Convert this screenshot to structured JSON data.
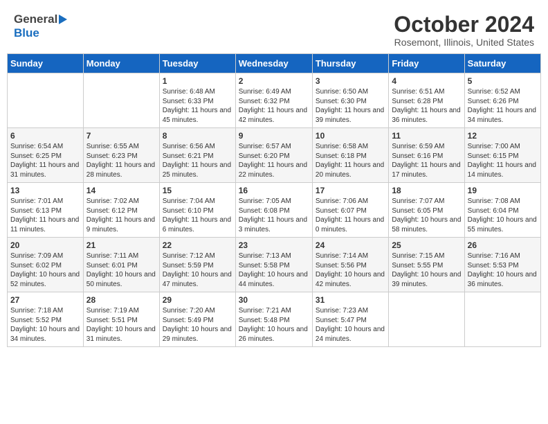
{
  "header": {
    "logo_general": "General",
    "logo_blue": "Blue",
    "month": "October 2024",
    "location": "Rosemont, Illinois, United States"
  },
  "days_of_week": [
    "Sunday",
    "Monday",
    "Tuesday",
    "Wednesday",
    "Thursday",
    "Friday",
    "Saturday"
  ],
  "weeks": [
    [
      {
        "day": "",
        "sunrise": "",
        "sunset": "",
        "daylight": ""
      },
      {
        "day": "",
        "sunrise": "",
        "sunset": "",
        "daylight": ""
      },
      {
        "day": "1",
        "sunrise": "Sunrise: 6:48 AM",
        "sunset": "Sunset: 6:33 PM",
        "daylight": "Daylight: 11 hours and 45 minutes."
      },
      {
        "day": "2",
        "sunrise": "Sunrise: 6:49 AM",
        "sunset": "Sunset: 6:32 PM",
        "daylight": "Daylight: 11 hours and 42 minutes."
      },
      {
        "day": "3",
        "sunrise": "Sunrise: 6:50 AM",
        "sunset": "Sunset: 6:30 PM",
        "daylight": "Daylight: 11 hours and 39 minutes."
      },
      {
        "day": "4",
        "sunrise": "Sunrise: 6:51 AM",
        "sunset": "Sunset: 6:28 PM",
        "daylight": "Daylight: 11 hours and 36 minutes."
      },
      {
        "day": "5",
        "sunrise": "Sunrise: 6:52 AM",
        "sunset": "Sunset: 6:26 PM",
        "daylight": "Daylight: 11 hours and 34 minutes."
      }
    ],
    [
      {
        "day": "6",
        "sunrise": "Sunrise: 6:54 AM",
        "sunset": "Sunset: 6:25 PM",
        "daylight": "Daylight: 11 hours and 31 minutes."
      },
      {
        "day": "7",
        "sunrise": "Sunrise: 6:55 AM",
        "sunset": "Sunset: 6:23 PM",
        "daylight": "Daylight: 11 hours and 28 minutes."
      },
      {
        "day": "8",
        "sunrise": "Sunrise: 6:56 AM",
        "sunset": "Sunset: 6:21 PM",
        "daylight": "Daylight: 11 hours and 25 minutes."
      },
      {
        "day": "9",
        "sunrise": "Sunrise: 6:57 AM",
        "sunset": "Sunset: 6:20 PM",
        "daylight": "Daylight: 11 hours and 22 minutes."
      },
      {
        "day": "10",
        "sunrise": "Sunrise: 6:58 AM",
        "sunset": "Sunset: 6:18 PM",
        "daylight": "Daylight: 11 hours and 20 minutes."
      },
      {
        "day": "11",
        "sunrise": "Sunrise: 6:59 AM",
        "sunset": "Sunset: 6:16 PM",
        "daylight": "Daylight: 11 hours and 17 minutes."
      },
      {
        "day": "12",
        "sunrise": "Sunrise: 7:00 AM",
        "sunset": "Sunset: 6:15 PM",
        "daylight": "Daylight: 11 hours and 14 minutes."
      }
    ],
    [
      {
        "day": "13",
        "sunrise": "Sunrise: 7:01 AM",
        "sunset": "Sunset: 6:13 PM",
        "daylight": "Daylight: 11 hours and 11 minutes."
      },
      {
        "day": "14",
        "sunrise": "Sunrise: 7:02 AM",
        "sunset": "Sunset: 6:12 PM",
        "daylight": "Daylight: 11 hours and 9 minutes."
      },
      {
        "day": "15",
        "sunrise": "Sunrise: 7:04 AM",
        "sunset": "Sunset: 6:10 PM",
        "daylight": "Daylight: 11 hours and 6 minutes."
      },
      {
        "day": "16",
        "sunrise": "Sunrise: 7:05 AM",
        "sunset": "Sunset: 6:08 PM",
        "daylight": "Daylight: 11 hours and 3 minutes."
      },
      {
        "day": "17",
        "sunrise": "Sunrise: 7:06 AM",
        "sunset": "Sunset: 6:07 PM",
        "daylight": "Daylight: 11 hours and 0 minutes."
      },
      {
        "day": "18",
        "sunrise": "Sunrise: 7:07 AM",
        "sunset": "Sunset: 6:05 PM",
        "daylight": "Daylight: 10 hours and 58 minutes."
      },
      {
        "day": "19",
        "sunrise": "Sunrise: 7:08 AM",
        "sunset": "Sunset: 6:04 PM",
        "daylight": "Daylight: 10 hours and 55 minutes."
      }
    ],
    [
      {
        "day": "20",
        "sunrise": "Sunrise: 7:09 AM",
        "sunset": "Sunset: 6:02 PM",
        "daylight": "Daylight: 10 hours and 52 minutes."
      },
      {
        "day": "21",
        "sunrise": "Sunrise: 7:11 AM",
        "sunset": "Sunset: 6:01 PM",
        "daylight": "Daylight: 10 hours and 50 minutes."
      },
      {
        "day": "22",
        "sunrise": "Sunrise: 7:12 AM",
        "sunset": "Sunset: 5:59 PM",
        "daylight": "Daylight: 10 hours and 47 minutes."
      },
      {
        "day": "23",
        "sunrise": "Sunrise: 7:13 AM",
        "sunset": "Sunset: 5:58 PM",
        "daylight": "Daylight: 10 hours and 44 minutes."
      },
      {
        "day": "24",
        "sunrise": "Sunrise: 7:14 AM",
        "sunset": "Sunset: 5:56 PM",
        "daylight": "Daylight: 10 hours and 42 minutes."
      },
      {
        "day": "25",
        "sunrise": "Sunrise: 7:15 AM",
        "sunset": "Sunset: 5:55 PM",
        "daylight": "Daylight: 10 hours and 39 minutes."
      },
      {
        "day": "26",
        "sunrise": "Sunrise: 7:16 AM",
        "sunset": "Sunset: 5:53 PM",
        "daylight": "Daylight: 10 hours and 36 minutes."
      }
    ],
    [
      {
        "day": "27",
        "sunrise": "Sunrise: 7:18 AM",
        "sunset": "Sunset: 5:52 PM",
        "daylight": "Daylight: 10 hours and 34 minutes."
      },
      {
        "day": "28",
        "sunrise": "Sunrise: 7:19 AM",
        "sunset": "Sunset: 5:51 PM",
        "daylight": "Daylight: 10 hours and 31 minutes."
      },
      {
        "day": "29",
        "sunrise": "Sunrise: 7:20 AM",
        "sunset": "Sunset: 5:49 PM",
        "daylight": "Daylight: 10 hours and 29 minutes."
      },
      {
        "day": "30",
        "sunrise": "Sunrise: 7:21 AM",
        "sunset": "Sunset: 5:48 PM",
        "daylight": "Daylight: 10 hours and 26 minutes."
      },
      {
        "day": "31",
        "sunrise": "Sunrise: 7:23 AM",
        "sunset": "Sunset: 5:47 PM",
        "daylight": "Daylight: 10 hours and 24 minutes."
      },
      {
        "day": "",
        "sunrise": "",
        "sunset": "",
        "daylight": ""
      },
      {
        "day": "",
        "sunrise": "",
        "sunset": "",
        "daylight": ""
      }
    ]
  ]
}
